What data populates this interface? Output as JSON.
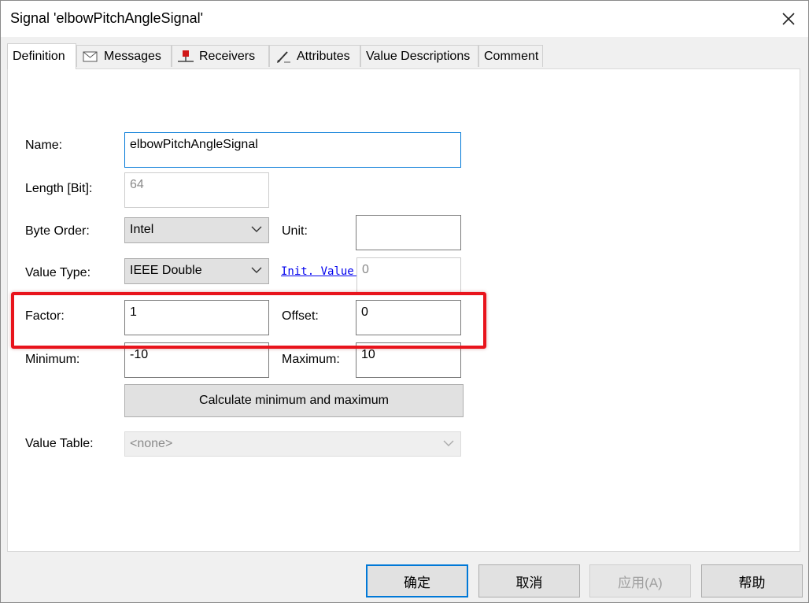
{
  "window": {
    "title": "Signal 'elbowPitchAngleSignal'"
  },
  "tabs": [
    {
      "label": "Definition",
      "icon": "none"
    },
    {
      "label": "Messages",
      "icon": "envelope-icon"
    },
    {
      "label": "Receivers",
      "icon": "receiver-node-icon"
    },
    {
      "label": "Attributes",
      "icon": "pencil-icon"
    },
    {
      "label": "Value Descriptions",
      "icon": "none"
    },
    {
      "label": "Comment",
      "icon": "none"
    }
  ],
  "form": {
    "name": {
      "label": "Name:",
      "value": "elbowPitchAngleSignal"
    },
    "length": {
      "label": "Length [Bit]:",
      "value": "64"
    },
    "byte_order": {
      "label": "Byte Order:",
      "value": "Intel"
    },
    "unit": {
      "label": "Unit:",
      "value": ""
    },
    "value_type": {
      "label": "Value Type:",
      "value": "IEEE Double"
    },
    "init_value": {
      "label": "Init. Value:",
      "value": "0"
    },
    "factor": {
      "label": "Factor:",
      "value": "1"
    },
    "offset": {
      "label": "Offset:",
      "value": "0"
    },
    "minimum": {
      "label": "Minimum:",
      "value": "-10"
    },
    "maximum": {
      "label": "Maximum:",
      "value": "10"
    },
    "calc_button": "Calculate minimum and maximum",
    "value_table": {
      "label": "Value Table:",
      "value": "<none>"
    }
  },
  "buttons": {
    "ok": "确定",
    "cancel": "取消",
    "apply": "应用(A)",
    "help": "帮助"
  },
  "colors": {
    "highlight": "#e8141c",
    "focus": "#0078d7",
    "link": "#0000ee"
  }
}
